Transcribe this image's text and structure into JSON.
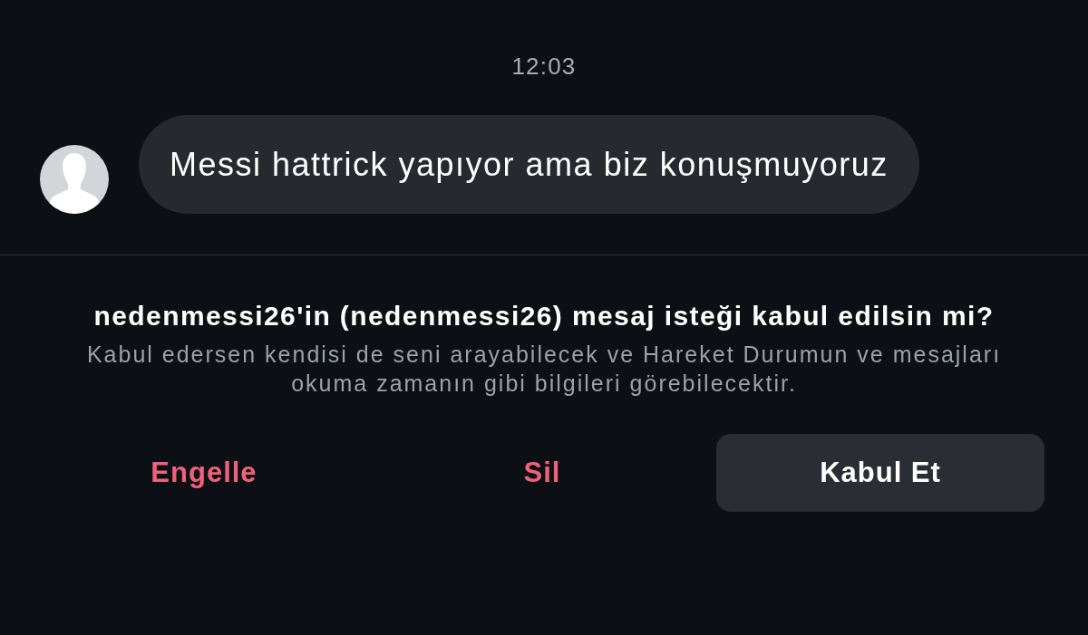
{
  "timestamp": "12:03",
  "messages": [
    {
      "text": "Messi hattrick yapıyor ama biz konuşmuyoruz"
    }
  ],
  "request": {
    "title": "nedenmessi26'in (nedenmessi26) mesaj isteği kabul edilsin mi?",
    "description": "Kabul edersen kendisi de seni arayabilecek ve Hareket Durumun ve mesajları okuma zamanın gibi bilgileri görebilecektir."
  },
  "actions": [
    {
      "label": "Engelle",
      "kind": "destructive"
    },
    {
      "label": "Sil",
      "kind": "destructive"
    },
    {
      "label": "Kabul Et",
      "kind": "primary"
    }
  ]
}
